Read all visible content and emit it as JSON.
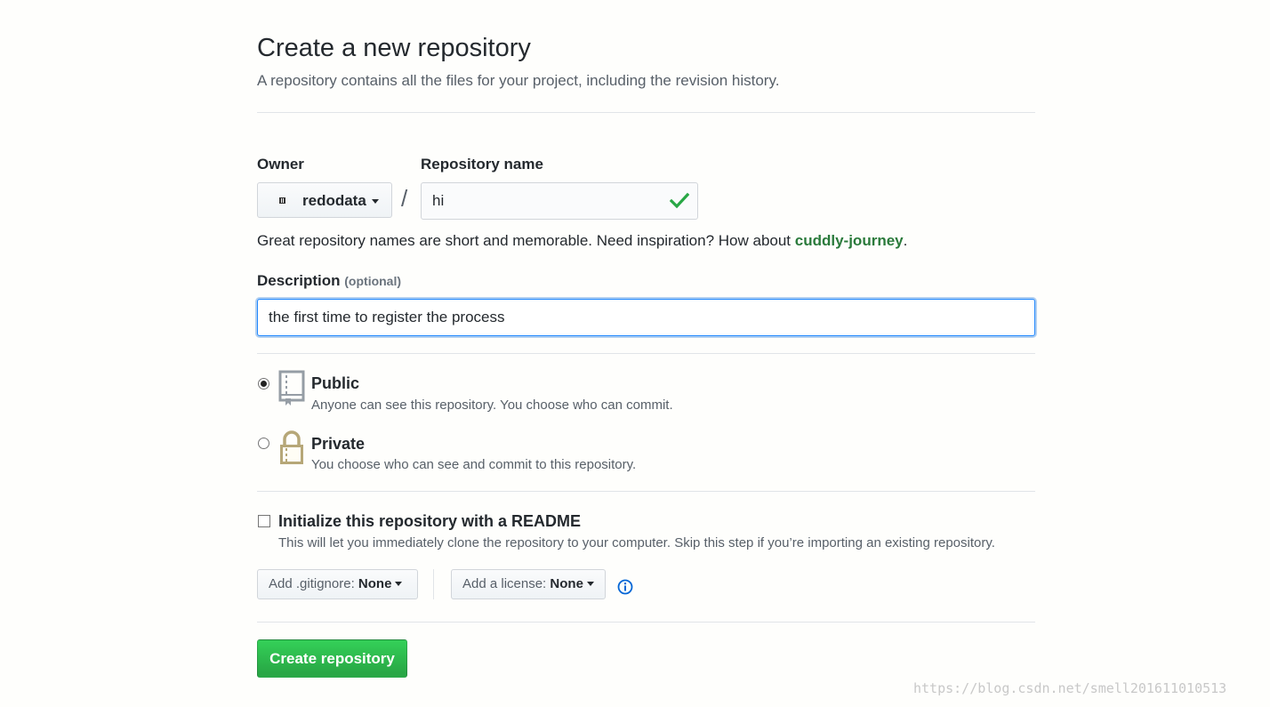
{
  "header": {
    "title": "Create a new repository",
    "subtitle": "A repository contains all the files for your project, including the revision history."
  },
  "owner": {
    "label": "Owner",
    "value": "redodata",
    "avatar_icon": "identicon-avatar"
  },
  "separator": "/",
  "repo_name": {
    "label": "Repository name",
    "value": "hi",
    "status_icon": "check-icon",
    "status_color": "#28a745"
  },
  "name_hint": {
    "prefix": "Great repository names are short and memorable. Need inspiration? How about ",
    "suggestion": "cuddly-journey",
    "suffix": "."
  },
  "description": {
    "label": "Description",
    "optional_label": "(optional)",
    "value": "the first time to register the process"
  },
  "visibility": {
    "public": {
      "title": "Public",
      "description": "Anyone can see this repository. You choose who can commit.",
      "selected": true,
      "icon": "repo-book-icon"
    },
    "private": {
      "title": "Private",
      "description": "You choose who can see and commit to this repository.",
      "selected": false,
      "icon": "lock-icon"
    }
  },
  "readme": {
    "label": "Initialize this repository with a README",
    "description": "This will let you immediately clone the repository to your computer. Skip this step if you’re importing an existing repository.",
    "checked": false
  },
  "gitignore": {
    "prefix": "Add .gitignore:",
    "value": "None"
  },
  "license": {
    "prefix": "Add a license:",
    "value": "None",
    "info_icon": "info-icon"
  },
  "submit": {
    "label": "Create repository",
    "color": "#28a745"
  },
  "watermark": "https://blog.csdn.net/smell201611010513"
}
